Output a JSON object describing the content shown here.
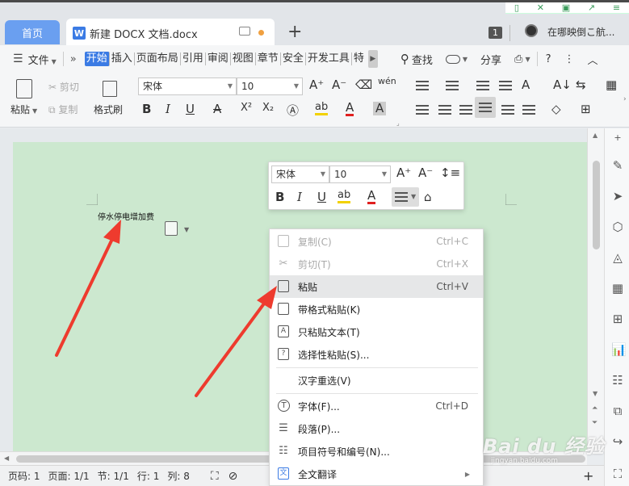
{
  "tabs": {
    "home": "首页",
    "doc_title": "新建 DOCX 文档.docx",
    "doc_icon_letter": "W",
    "add": "+",
    "window_count": "1",
    "location_text": "在哪映倒こ航..."
  },
  "menubar": {
    "file": "文件",
    "more": "»",
    "tabs": [
      "开始",
      "插入",
      "页面布局",
      "引用",
      "审阅",
      "视图",
      "章节",
      "安全",
      "开发工具",
      "特"
    ],
    "active_tab": "开始",
    "search": "查找",
    "share": "分享",
    "help": "?",
    "more_vert": "⋮",
    "collapse": "︿"
  },
  "ribbon": {
    "paste": "粘贴",
    "cut": "剪切",
    "copy": "复制",
    "format_painter": "格式刷",
    "font_name": "宋体",
    "font_size": "10",
    "bold": "B",
    "italic": "I",
    "underline": "U",
    "strike": "A",
    "superscript": "X²",
    "subscript": "X₂"
  },
  "page": {
    "text": "停水停电增加费"
  },
  "mini_toolbar": {
    "font_name": "宋体",
    "font_size": "10",
    "bold": "B",
    "italic": "I",
    "underline": "U"
  },
  "context_menu": [
    {
      "label": "复制(C)",
      "shortcut": "Ctrl+C",
      "icon": "copy-icon",
      "disabled": true
    },
    {
      "label": "剪切(T)",
      "shortcut": "Ctrl+X",
      "icon": "scissors-icon",
      "disabled": true
    },
    {
      "label": "粘贴",
      "shortcut": "Ctrl+V",
      "icon": "paste-icon",
      "hover": true
    },
    {
      "label": "带格式粘贴(K)",
      "shortcut": "",
      "icon": "paste-format-icon"
    },
    {
      "label": "只粘贴文本(T)",
      "shortcut": "",
      "icon": "paste-text-icon"
    },
    {
      "label": "选择性粘贴(S)...",
      "shortcut": "",
      "icon": "paste-special-icon"
    },
    {
      "label": "汉字重选(V)",
      "shortcut": "",
      "icon": ""
    },
    {
      "label": "字体(F)...",
      "shortcut": "Ctrl+D",
      "icon": "font-icon"
    },
    {
      "label": "段落(P)...",
      "shortcut": "",
      "icon": "paragraph-icon"
    },
    {
      "label": "项目符号和编号(N)...",
      "shortcut": "",
      "icon": "list-icon"
    },
    {
      "label": "全文翻译",
      "shortcut": "",
      "icon": "translate-icon",
      "submenu": true
    }
  ],
  "status": {
    "page_num": "页码: 1",
    "pages": "页面: 1/1",
    "section": "节: 1/1",
    "row": "行: 1",
    "col": "列: 8"
  },
  "watermark": {
    "main": "Bai du 经验",
    "sub": "jingyan.baidu.com"
  },
  "colors": {
    "accent": "#3b7be4",
    "home_tab": "#6a9ff0",
    "page_bg": "#cce8cf",
    "arrow": "#ee3b2e"
  }
}
